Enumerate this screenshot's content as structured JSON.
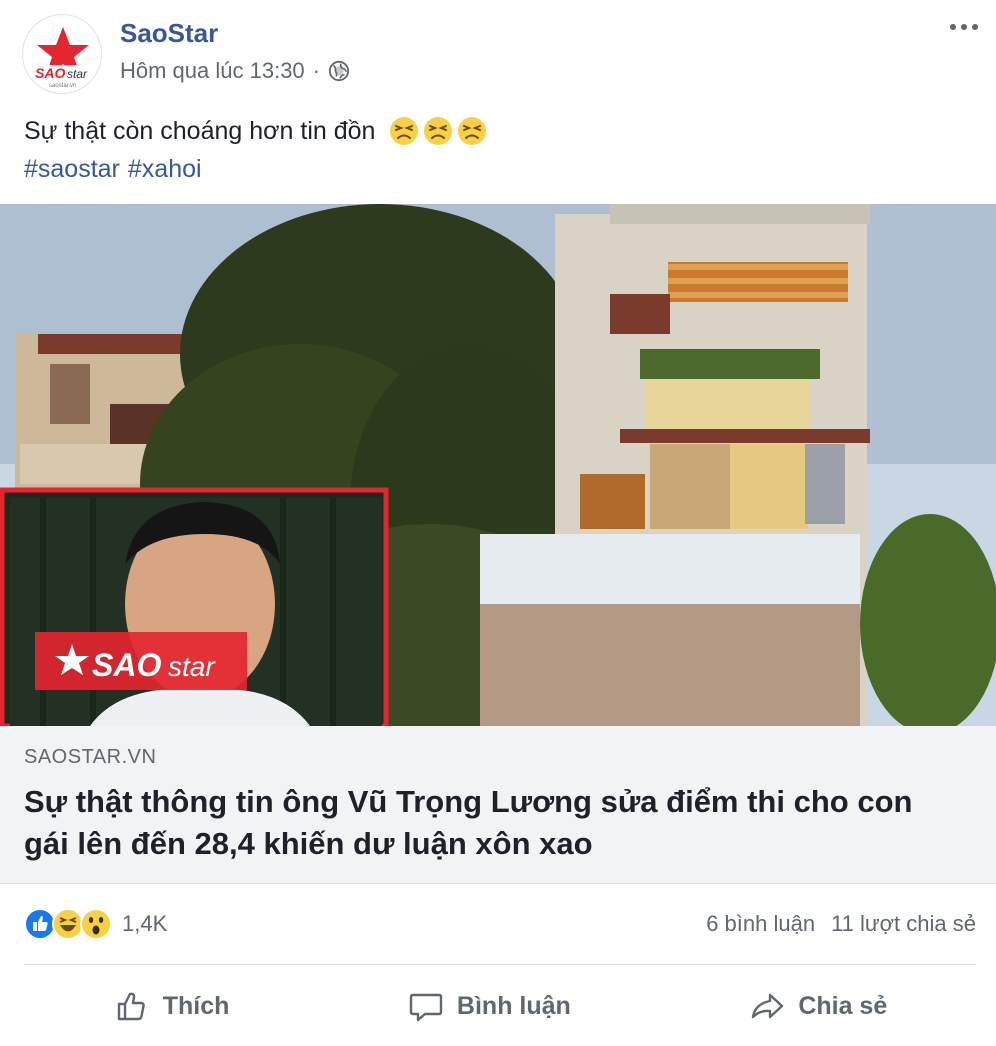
{
  "post": {
    "page_name": "SaoStar",
    "timestamp": "Hôm qua lúc 13:30",
    "separator": "·",
    "privacy_icon": "globe-icon",
    "more_icon": "more-options-icon",
    "text": "Sự thật còn choáng hơn tin đồn",
    "hashtags": [
      "#saostar",
      "#xahoi"
    ]
  },
  "avatar": {
    "logo_text": "SAO",
    "logo_text2": "star",
    "logo_sub": "saostar.vn"
  },
  "link": {
    "watermark_sao": "SAO",
    "watermark_star": "star",
    "domain": "SAOSTAR.VN",
    "title": "Sự thật thông tin ông Vũ Trọng Lương sửa điểm thi cho con gái lên đến 28,4 khiến dư luận xôn xao"
  },
  "engagement": {
    "reaction_count": "1,4K",
    "reactions": [
      "like",
      "haha",
      "wow"
    ],
    "comments": "6 bình luận",
    "shares": "11 lượt chia sẻ"
  },
  "actions": {
    "like": "Thích",
    "comment": "Bình luận",
    "share": "Chia sẻ"
  },
  "colors": {
    "link_blue": "#365899",
    "muted": "#606770",
    "like_blue": "#1877f2",
    "emoji_yellow": "#f7d046",
    "brand_red": "#e5252f"
  }
}
